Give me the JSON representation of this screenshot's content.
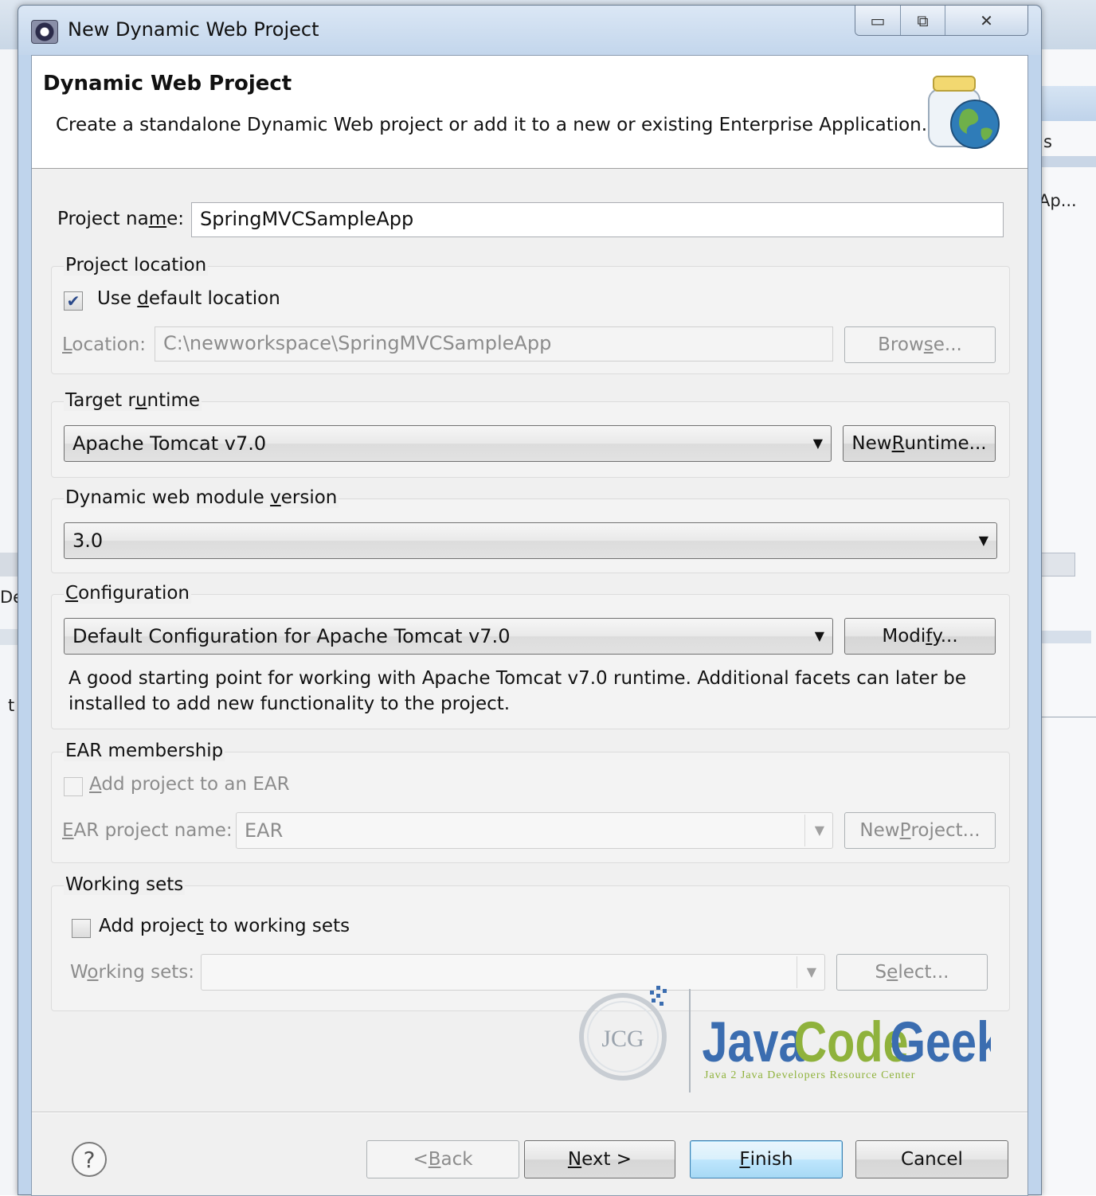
{
  "window": {
    "title": "New Dynamic Web Project",
    "minimize_glyph": "▭",
    "maximize_glyph": "⧉",
    "close_glyph": "✕"
  },
  "background": {
    "right_text_1": "s",
    "right_text_2": "Ap...",
    "left_text_1": "De",
    "left_text_2": "t"
  },
  "header": {
    "title": "Dynamic Web Project",
    "description": "Create a standalone Dynamic Web project or add it to a new or existing Enterprise Application."
  },
  "project_name": {
    "label_pre": "Project na",
    "label_mnemonic": "m",
    "label_post": "e:",
    "value": "SpringMVCSampleApp"
  },
  "project_location": {
    "group_label": "Project location",
    "use_default_pre": "Use ",
    "use_default_mnemonic": "d",
    "use_default_post": "efault location",
    "use_default_checked": true,
    "location_label_mnemonic": "L",
    "location_label_post": "ocation:",
    "location_value": "C:\\newworkspace\\SpringMVCSampleApp",
    "browse_pre": "Brow",
    "browse_mnemonic": "s",
    "browse_post": "e..."
  },
  "target_runtime": {
    "group_label_pre": "Target r",
    "group_label_mnemonic": "u",
    "group_label_post": "ntime",
    "selected": "Apache Tomcat v7.0",
    "new_runtime_pre": "New ",
    "new_runtime_mnemonic": "R",
    "new_runtime_post": "untime..."
  },
  "module_version": {
    "group_label_pre": "Dynamic web module ",
    "group_label_mnemonic": "v",
    "group_label_post": "ersion",
    "selected": "3.0"
  },
  "configuration": {
    "group_label_mnemonic": "C",
    "group_label_post": "onfiguration",
    "selected": "Default Configuration for Apache Tomcat v7.0",
    "modify_pre": "Modi",
    "modify_mnemonic": "f",
    "modify_post": "y...",
    "description_line1": "A good starting point for working with Apache Tomcat v7.0 runtime. Additional facets can later be",
    "description_line2": "installed to add new functionality to the project."
  },
  "ear_membership": {
    "group_label": "EAR membership",
    "add_ear_mnemonic": "A",
    "add_ear_post": "dd project to an EAR",
    "add_ear_checked": false,
    "ear_name_label_mnemonic": "E",
    "ear_name_label_post": "AR project name:",
    "ear_name_value": "EAR",
    "new_project_pre": "New ",
    "new_project_mnemonic": "P",
    "new_project_post": "roject..."
  },
  "working_sets": {
    "group_label": "Working sets",
    "add_ws_pre": "Add projec",
    "add_ws_mnemonic": "t",
    "add_ws_post": " to working sets",
    "add_ws_checked": false,
    "ws_label_pre": "W",
    "ws_label_mnemonic": "o",
    "ws_label_post": "rking sets:",
    "ws_value": "",
    "select_pre": "S",
    "select_mnemonic": "e",
    "select_post": "lect..."
  },
  "watermark": {
    "badge": "JCG",
    "brand_java": "Java",
    "brand_code": "Code",
    "brand_geeks": "Geeks",
    "tagline": "Java 2 Java Developers Resource Center"
  },
  "footer": {
    "help_glyph": "?",
    "back_pre": "< ",
    "back_mnemonic": "B",
    "back_post": "ack",
    "next_mnemonic": "N",
    "next_post": "ext >",
    "finish_mnemonic": "F",
    "finish_post": "inish",
    "cancel": "Cancel"
  },
  "colors": {
    "brand_blue": "#3b6db0",
    "brand_green": "#8fb23c",
    "accent_border": "#3c7fb1"
  }
}
